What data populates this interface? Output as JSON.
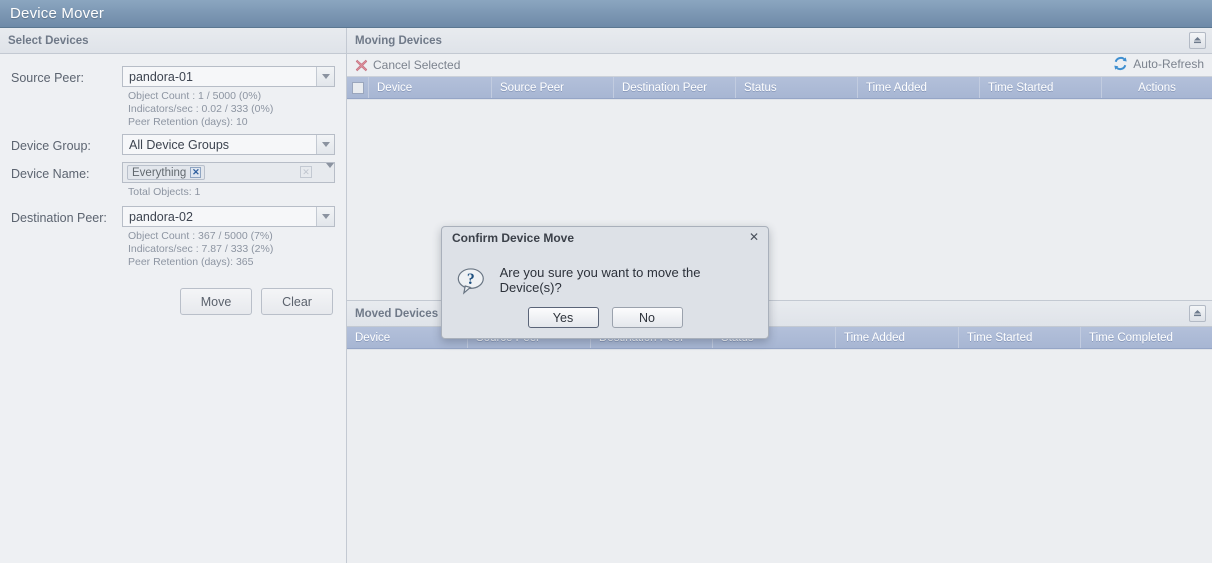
{
  "app": {
    "title": "Device Mover"
  },
  "left_panel": {
    "header": "Select Devices",
    "collapse_icon": "collapse-up-icon",
    "fields": {
      "source_peer": {
        "label": "Source Peer:",
        "value": "pandora-01",
        "meta": [
          "Object Count : 1 / 5000 (0%)",
          "Indicators/sec : 0.02 / 333 (0%)",
          "Peer Retention (days): 10"
        ]
      },
      "device_group": {
        "label": "Device Group:",
        "value": "All Device Groups"
      },
      "device_name": {
        "label": "Device Name:",
        "tag": "Everything",
        "tag_remove_icon": "remove-tag-icon",
        "clear_icon": "clear-field-icon",
        "meta": [
          "Total Objects: 1"
        ]
      },
      "destination_peer": {
        "label": "Destination Peer:",
        "value": "pandora-02",
        "meta": [
          "Object Count : 367 / 5000 (7%)",
          "Indicators/sec : 7.87 / 333 (2%)",
          "Peer Retention (days): 365"
        ]
      }
    },
    "buttons": {
      "move": "Move",
      "clear": "Clear"
    }
  },
  "moving_devices": {
    "header": "Moving Devices",
    "collapse_icon": "collapse-up-icon",
    "toolbar": {
      "cancel_selected": "Cancel Selected",
      "cancel_icon": "cancel-x-icon",
      "auto_refresh": "Auto-Refresh",
      "refresh_icon": "refresh-icon"
    },
    "columns": [
      {
        "label": "",
        "width": 22,
        "type": "checkbox"
      },
      {
        "label": "Device",
        "width": 123
      },
      {
        "label": "Source Peer",
        "width": 122
      },
      {
        "label": "Destination Peer",
        "width": 122
      },
      {
        "label": "Status",
        "width": 122
      },
      {
        "label": "Time Added",
        "width": 122
      },
      {
        "label": "Time Started",
        "width": 122
      },
      {
        "label": "Actions",
        "width": 110,
        "align": "center"
      }
    ],
    "rows": []
  },
  "moved_devices": {
    "header": "Moved Devices",
    "collapse_icon": "collapse-up-icon",
    "columns": [
      {
        "label": "Device",
        "width": 121
      },
      {
        "label": "Source Peer",
        "width": 123
      },
      {
        "label": "Destination Peer",
        "width": 122
      },
      {
        "label": "Status",
        "width": 123
      },
      {
        "label": "Time Added",
        "width": 123
      },
      {
        "label": "Time Started",
        "width": 122
      },
      {
        "label": "Time Completed",
        "width": 121
      }
    ],
    "rows": []
  },
  "dialog": {
    "title": "Confirm Device Move",
    "close_icon": "close-icon",
    "question_icon": "question-bubble-icon",
    "message": "Are you sure you want to move the Device(s)?",
    "yes": "Yes",
    "no": "No"
  },
  "colors": {
    "titlebar": "#7c97b3",
    "grid_header": "#a7b6d3",
    "accent_link": "#2f5f9e",
    "cancel_icon": "#d98f9b",
    "refresh_icon": "#3f8fd0"
  }
}
